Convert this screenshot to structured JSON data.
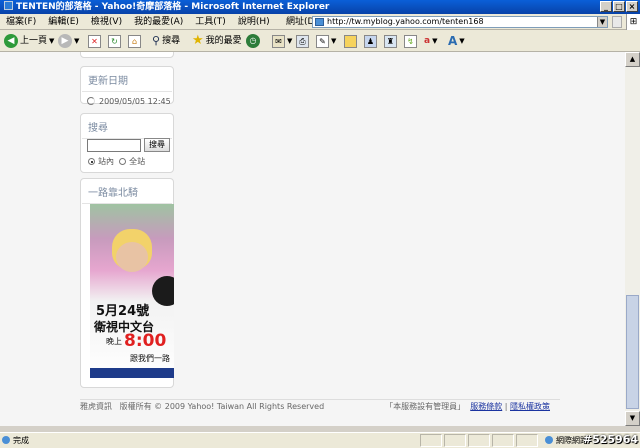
{
  "window": {
    "title": "TENTEN的部落格 - Yahoo!奇摩部落格 - Microsoft Internet Explorer"
  },
  "menu": [
    "檔案(F)",
    "編輯(E)",
    "檢視(V)",
    "我的最愛(A)",
    "工具(T)",
    "說明(H)"
  ],
  "address": {
    "label": "網址(D)",
    "url": "http://tw.myblog.yahoo.com/tenten168"
  },
  "toolbar": {
    "back": "上一頁",
    "search": "搜尋",
    "favorites": "我的最愛"
  },
  "sidebar": {
    "updated": {
      "title": "更新日期",
      "date": "2009/05/05 12:45"
    },
    "search": {
      "title": "搜尋",
      "button": "搜尋",
      "option_site": "站內",
      "option_all": "全站",
      "selected": "站內"
    },
    "promo": {
      "title": "一路靠北騎",
      "date_line": "5月24號",
      "channel": "衛視中文台",
      "evening": "晚上",
      "time": "8:00",
      "tagline": "跟我們一路"
    }
  },
  "footer": {
    "brand": "雅虎資訊",
    "copyright": "版權所有 © 2009 Yahoo! Taiwan All Rights Reserved",
    "note": "「本服務設有管理員」",
    "terms": "服務條款",
    "privacy": "隱私權政策"
  },
  "status": {
    "text": "完成",
    "zone": "網際網路"
  },
  "watermark": "#525964"
}
